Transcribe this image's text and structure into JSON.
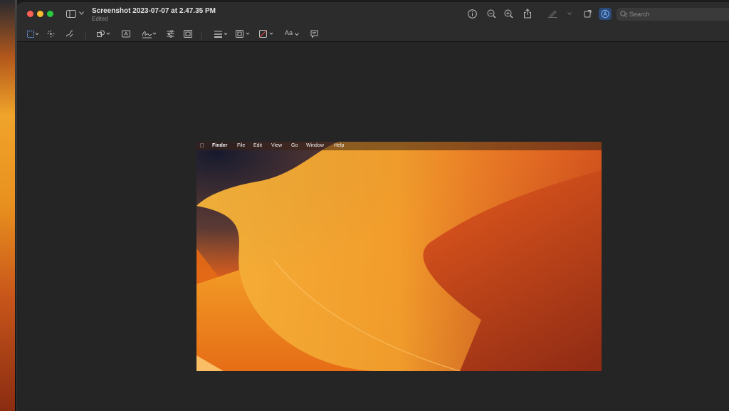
{
  "window": {
    "title": "Screenshot 2023-07-07 at 2.47.35 PM",
    "subtitle": "Edited"
  },
  "toolbar": {
    "icons": [
      "sidebar-icon",
      "chevron-down-icon",
      "info-icon",
      "zoom-out-icon",
      "zoom-in-icon",
      "share-icon",
      "highlight-icon",
      "rotate-icon",
      "markup-icon",
      "search-icon"
    ],
    "search_placeholder": "Search"
  },
  "markup_toolbar": {
    "icons": [
      "rect-select-icon",
      "instant-alpha-icon",
      "sketch-icon",
      "shapes-icon",
      "text-box-icon",
      "signature-icon",
      "adjust-color-icon",
      "adjust-size-icon",
      "line-style-icon",
      "border-color-icon",
      "fill-color-icon",
      "text-style-icon",
      "note-icon"
    ],
    "text_style_label": "Aa"
  },
  "screenshot": {
    "menubar": [
      "Finder",
      "File",
      "Edit",
      "View",
      "Go",
      "Window",
      "Help"
    ],
    "colors": {
      "accent": "#f2a72c",
      "deep": "#b83a1a"
    }
  }
}
